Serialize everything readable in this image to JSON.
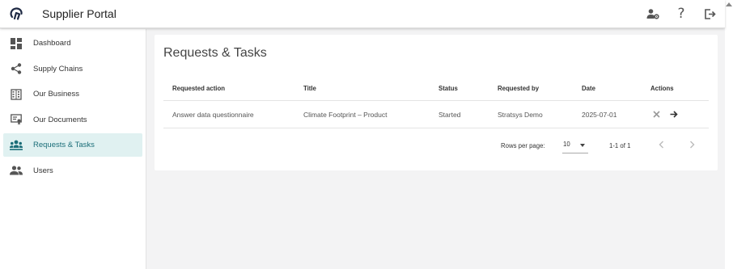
{
  "app": {
    "title": "Supplier Portal"
  },
  "header": {
    "icons": [
      "user-settings-icon",
      "help-icon",
      "logout-icon"
    ],
    "help_glyph": "?"
  },
  "sidebar": {
    "items": [
      {
        "label": "Dashboard",
        "icon": "dashboard-icon",
        "active": false
      },
      {
        "label": "Supply Chains",
        "icon": "share-icon",
        "active": false
      },
      {
        "label": "Our Business",
        "icon": "building-icon",
        "active": false
      },
      {
        "label": "Our Documents",
        "icon": "documents-icon",
        "active": false
      },
      {
        "label": "Requests & Tasks",
        "icon": "requests-icon",
        "active": true
      },
      {
        "label": "Users",
        "icon": "users-icon",
        "active": false
      }
    ]
  },
  "main": {
    "title": "Requests & Tasks",
    "columns": [
      "Requested action",
      "Title",
      "Status",
      "Requested by",
      "Date",
      "Actions"
    ],
    "rows": [
      {
        "requested_action": "Answer data questionnaire",
        "title": "Climate Footprint – Product",
        "status": "Started",
        "requested_by": "Stratsys Demo",
        "date": "2025-07-01"
      }
    ],
    "pagination": {
      "rows_per_page_label": "Rows per page:",
      "rows_per_page": "10",
      "range": "1-1 of 1"
    }
  },
  "colors": {
    "accent": "#1a6d78",
    "active_bg": "#e0f1f1",
    "background": "#f3f3f4"
  }
}
